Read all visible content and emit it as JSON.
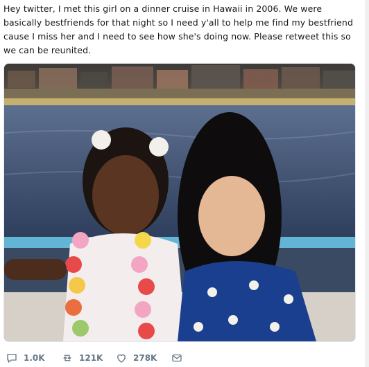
{
  "tweet": {
    "text": "Hey twitter, I met this girl on a dinner cruise in Hawaii in 2006. We were basically bestfriends for that night so I need y'all to help me find my bestfriend cause I miss her and I need to see how she's doing now. Please retweet this so we can be reunited.",
    "photo_icon": "photo-of-two-girls"
  },
  "actions": {
    "reply": {
      "icon": "reply-icon",
      "count": "1.0K"
    },
    "retweet": {
      "icon": "retweet-icon",
      "count": "121K"
    },
    "like": {
      "icon": "heart-icon",
      "count": "278K"
    },
    "message": {
      "icon": "envelope-icon"
    }
  },
  "colors": {
    "action_gray": "#657786",
    "text": "#14171a",
    "border": "#e1e8ed"
  }
}
